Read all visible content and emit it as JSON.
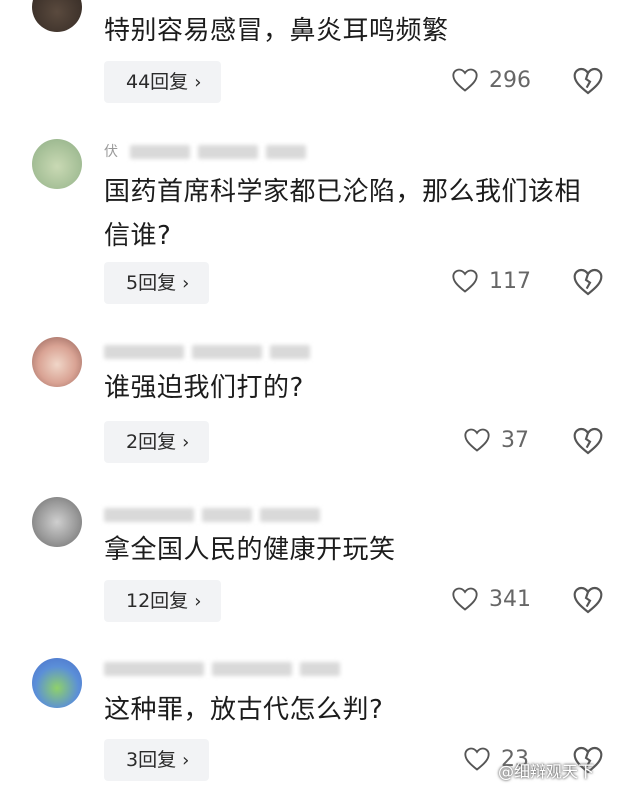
{
  "comments": [
    {
      "text": "特别容易感冒，鼻炎耳鸣频繁",
      "reply_label": "44回复",
      "likes": "296"
    },
    {
      "meta_prefix": "伏",
      "text": "国药首席科学家都已沦陷，那么我们该相信谁?",
      "reply_label": "5回复",
      "likes": "117"
    },
    {
      "text": "谁强迫我们打的?",
      "reply_label": "2回复",
      "likes": "37"
    },
    {
      "text": "拿全国人民的健康开玩笑",
      "reply_label": "12回复",
      "likes": "341"
    },
    {
      "text": "这种罪，放古代怎么判?",
      "reply_label": "3回复",
      "likes": "23"
    }
  ],
  "icons": {
    "reply_chevron": "chevron-right-icon",
    "like": "heart-outline-icon",
    "dislike": "broken-heart-icon"
  },
  "watermark": "@细辩观天下",
  "colors": {
    "reply_bg": "#f2f3f5",
    "text": "#1c1c1c",
    "meta": "#9a9a9a"
  }
}
